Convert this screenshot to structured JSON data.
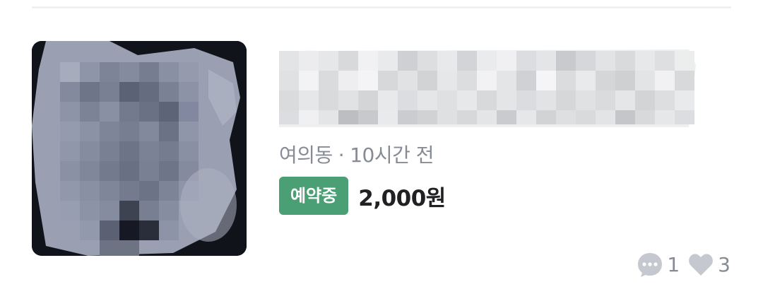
{
  "listing": {
    "location": "여의동",
    "separator": "·",
    "time_ago": "10시간 전",
    "status_badge": "예약중",
    "price": "2,000원",
    "chat_count": "1",
    "like_count": "3"
  },
  "colors": {
    "badge_green": "#4a9f75",
    "meta_gray": "#868b94",
    "price_text": "#212124",
    "icon_gray": "#c5c8ce"
  },
  "icons": {
    "chat": "chat-bubble-icon",
    "like": "heart-icon"
  }
}
